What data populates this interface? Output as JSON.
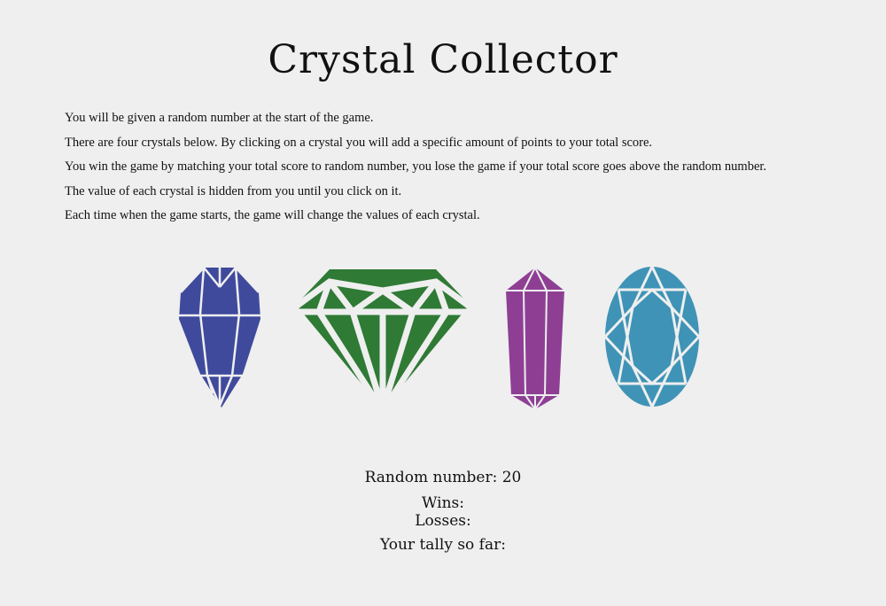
{
  "title": "Crystal Collector",
  "instructions": [
    "You will be given a random number at the start of the game.",
    "There are four crystals below. By clicking on a crystal you will add a specific amount of points to your total score.",
    "You win the game by matching your total score to random number, you lose the game if your total score goes above the random number.",
    "The value of each crystal is hidden from you until you click on it.",
    "Each time when the game starts, the game will change the values of each crystal."
  ],
  "crystals": [
    {
      "icon": "blue-crystal-icon",
      "color": "#3f4a9d"
    },
    {
      "icon": "green-diamond-icon",
      "color": "#2f7a35"
    },
    {
      "icon": "purple-crystal-icon",
      "color": "#8e3f94"
    },
    {
      "icon": "teal-oval-gem-icon",
      "color": "#3f93b6"
    }
  ],
  "stats": {
    "random_label": "Random number: 20",
    "wins_label": "Wins:",
    "losses_label": "Losses:",
    "tally_label": "Your tally so far:"
  }
}
